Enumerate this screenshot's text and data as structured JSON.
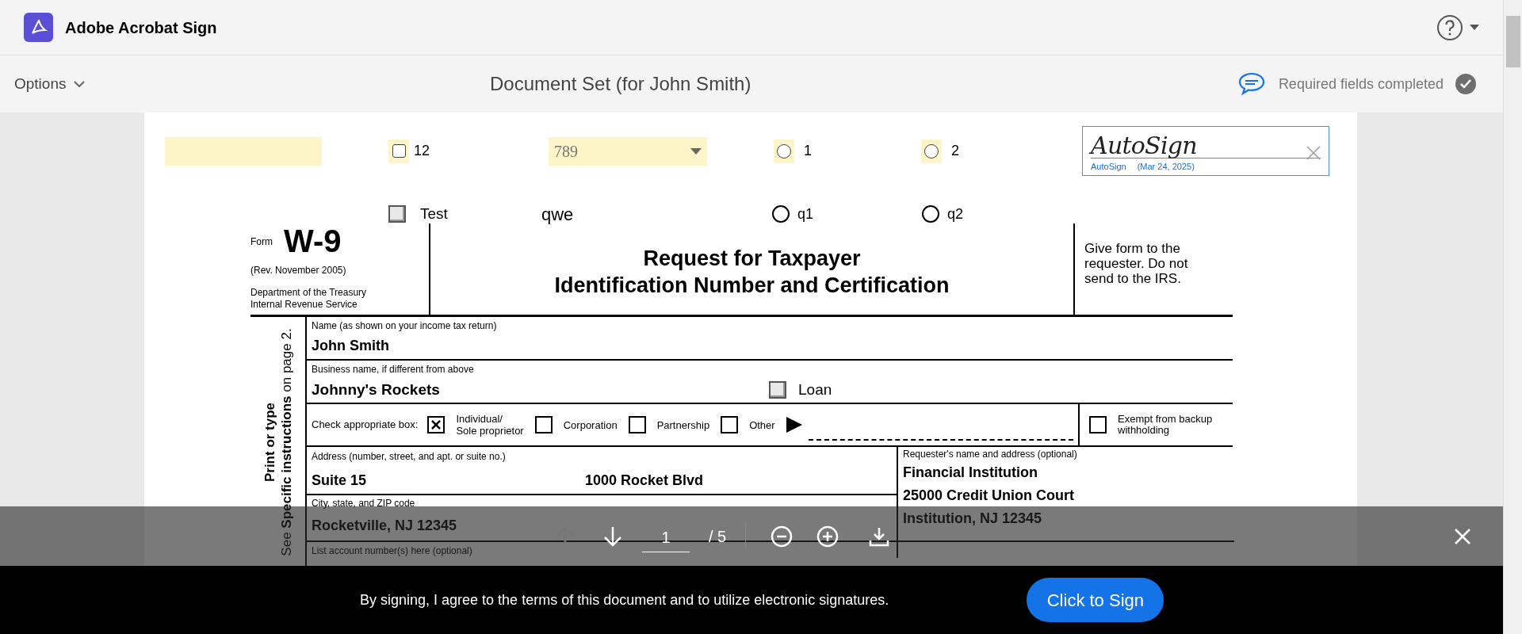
{
  "app": {
    "name": "Adobe Acrobat Sign"
  },
  "subbar": {
    "options": "Options",
    "title": "Document Set (for John Smith)",
    "status": {
      "text": "Required fields completed",
      "completed": true
    }
  },
  "top_fields": [
    {
      "kind": "text_field"
    },
    {
      "kind": "checkbox",
      "label": "12",
      "checked": false
    },
    {
      "kind": "dropdown",
      "value": "789"
    },
    {
      "kind": "radio",
      "label": "1",
      "selected": false
    },
    {
      "kind": "radio",
      "label": "2",
      "selected": false
    },
    {
      "kind": "signature",
      "signature": "AutoSign",
      "name": "AutoSign",
      "date": "(Mar 24, 2025)"
    }
  ],
  "second_row": [
    {
      "kind": "checkbox",
      "label": "Test",
      "checked": false
    },
    {
      "kind": "text",
      "value": "qwe"
    },
    {
      "kind": "radio",
      "label": "q1",
      "selected": false
    },
    {
      "kind": "radio",
      "label": "q2",
      "selected": false
    }
  ],
  "form": {
    "form_label": "Form",
    "number": "W-9",
    "revision": "(Rev. November 2005)",
    "department": "Department of the Treasury",
    "service": "Internal Revenue Service",
    "title_lines": [
      "Request for Taxpayer",
      "Identification Number and Certification"
    ],
    "note_lines": [
      "Give form to the",
      "requester. Do not",
      "send to the IRS."
    ],
    "side_lines": [
      "Print or type",
      "See **Specific instructions** on page 2."
    ],
    "name": {
      "label": "Name (as shown on your income tax return)",
      "value": "John Smith"
    },
    "business": {
      "label": "Business name, if different from above",
      "value": "Johnny's Rockets",
      "loan": {
        "label": "Loan",
        "checked": false
      }
    },
    "classification": {
      "label": "Check appropriate box:",
      "options": [
        {
          "label_lines": [
            "Individual/",
            "Sole proprietor"
          ],
          "checked": true
        },
        {
          "label_lines": [
            "Corporation"
          ],
          "checked": false
        },
        {
          "label_lines": [
            "Partnership"
          ],
          "checked": false
        },
        {
          "label_lines": [
            "Other"
          ],
          "checked": false
        }
      ],
      "exempt": {
        "label_lines": [
          "Exempt from backup",
          "withholding"
        ],
        "checked": false
      }
    },
    "address": {
      "label": "Address (number, street, and apt. or suite no.)",
      "values": [
        "Suite 15",
        "1000 Rocket Blvd"
      ]
    },
    "requester": {
      "label": "Requester's name and address (optional)",
      "lines": [
        "Financial Institution",
        "25000 Credit Union Court",
        "Institution, NJ 12345"
      ]
    },
    "city": {
      "label": "City, state, and ZIP code",
      "value": "Rocketville, NJ 12345"
    },
    "account": {
      "label": "List account number(s) here (optional)"
    }
  },
  "viewer_toolbar": {
    "prev_disabled": true,
    "page": "1",
    "total": "/ 5"
  },
  "consent": {
    "text": "By signing, I agree to the terms of this document and to utilize electronic signatures.",
    "button": "Click to Sign"
  }
}
